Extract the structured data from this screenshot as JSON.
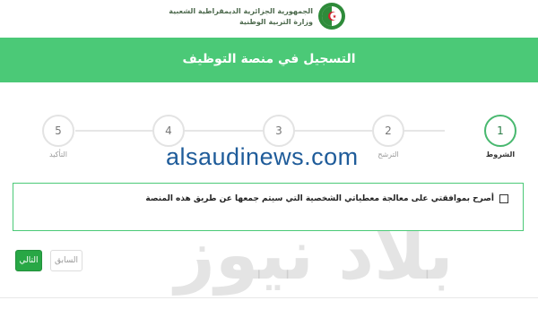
{
  "header": {
    "line1": "الجمهورية الجزائرية الديمقراطية الشعبية",
    "line2": "وزارة التربية الوطنية",
    "emblem_icon": "algeria-emblem-icon"
  },
  "banner": {
    "title": "التسجيل في منصة التوظيف",
    "color": "#4bc977"
  },
  "steps": [
    {
      "number": "1",
      "label": "الشروط",
      "active": true
    },
    {
      "number": "2",
      "label": "الترشح",
      "active": false
    },
    {
      "number": "3",
      "label": "",
      "active": false
    },
    {
      "number": "4",
      "label": "",
      "active": false
    },
    {
      "number": "5",
      "label": "التأكيد",
      "active": false
    }
  ],
  "watermark": {
    "site": "alsaudinews.com",
    "arabic": "بلاد نيوز"
  },
  "terms": {
    "text": "أصرح بموافقتي على معالجة معطياتي الشخصية التي سيتم جمعها عن طريق هذه المنصة",
    "checked": false
  },
  "buttons": {
    "next": "التالي",
    "previous": "السابق"
  },
  "colors": {
    "accent": "#4bc977",
    "button_green": "#28a745"
  }
}
